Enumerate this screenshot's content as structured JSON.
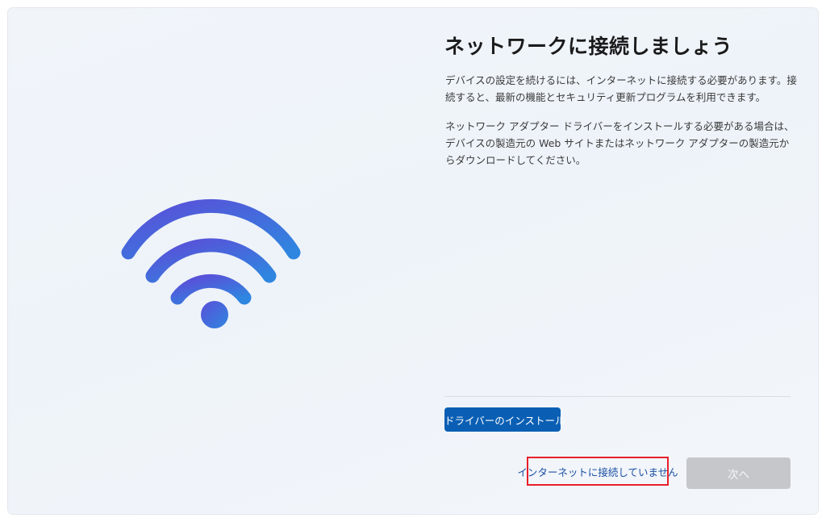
{
  "page": {
    "title": "ネットワークに接続しましょう",
    "description_1": "デバイスの設定を続けるには、インターネットに接続する必要があります。接続すると、最新の機能とセキュリティ更新プログラムを利用できます。",
    "description_2": "ネットワーク アダプター ドライバーをインストールする必要がある場合は、デバイスの製造元の Web サイトまたはネットワーク アダプターの製造元からダウンロードしてください。"
  },
  "hero": {
    "icon": "wifi-icon",
    "colors": {
      "start": "#5a4fd8",
      "end": "#2f86e0"
    }
  },
  "actions": {
    "install_driver_label": "ドライバーのインストール",
    "no_internet_label": "インターネットに接続していません",
    "next_label": "次へ",
    "next_enabled": false
  },
  "colors": {
    "primary_button": "#0a5fb4",
    "link": "#1a4fa3",
    "highlight_border": "#e8202a",
    "disabled_button": "#c5c7ca"
  }
}
